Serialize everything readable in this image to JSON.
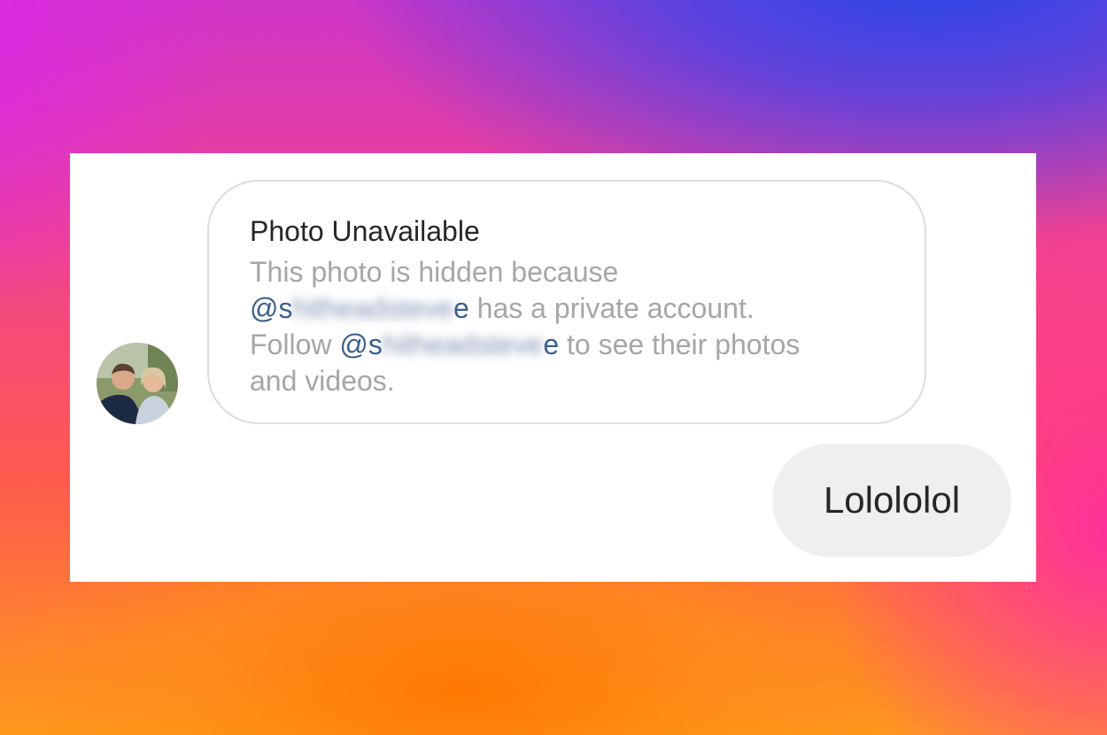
{
  "colors": {
    "panel": "#ffffff",
    "card_border": "#dcdcdc",
    "title_text": "#262626",
    "body_text": "#a6a6a6",
    "mention": "#3a5f8c",
    "bubble_bg": "#efefef",
    "gradient": [
      "#2347e8",
      "#cf35c6",
      "#f2448c",
      "#ff5a4e",
      "#ff9a1e"
    ]
  },
  "thread": {
    "incoming": {
      "avatar_icon": "profile-photo-couple",
      "card": {
        "title": "Photo Unavailable",
        "line1": "This photo is hidden because",
        "mention1_prefix": "@s",
        "mention1_hidden": "hitheadsteve",
        "mention1_suffix": "e",
        "line2_rest": " has a private account.",
        "line3_start": "Follow ",
        "mention2_prefix": "@s",
        "mention2_hidden": "hitheadsteve",
        "mention2_suffix": "e",
        "line3_rest": " to see their photos",
        "line4": "and videos."
      }
    },
    "outgoing": {
      "text": "Lolololol"
    }
  }
}
